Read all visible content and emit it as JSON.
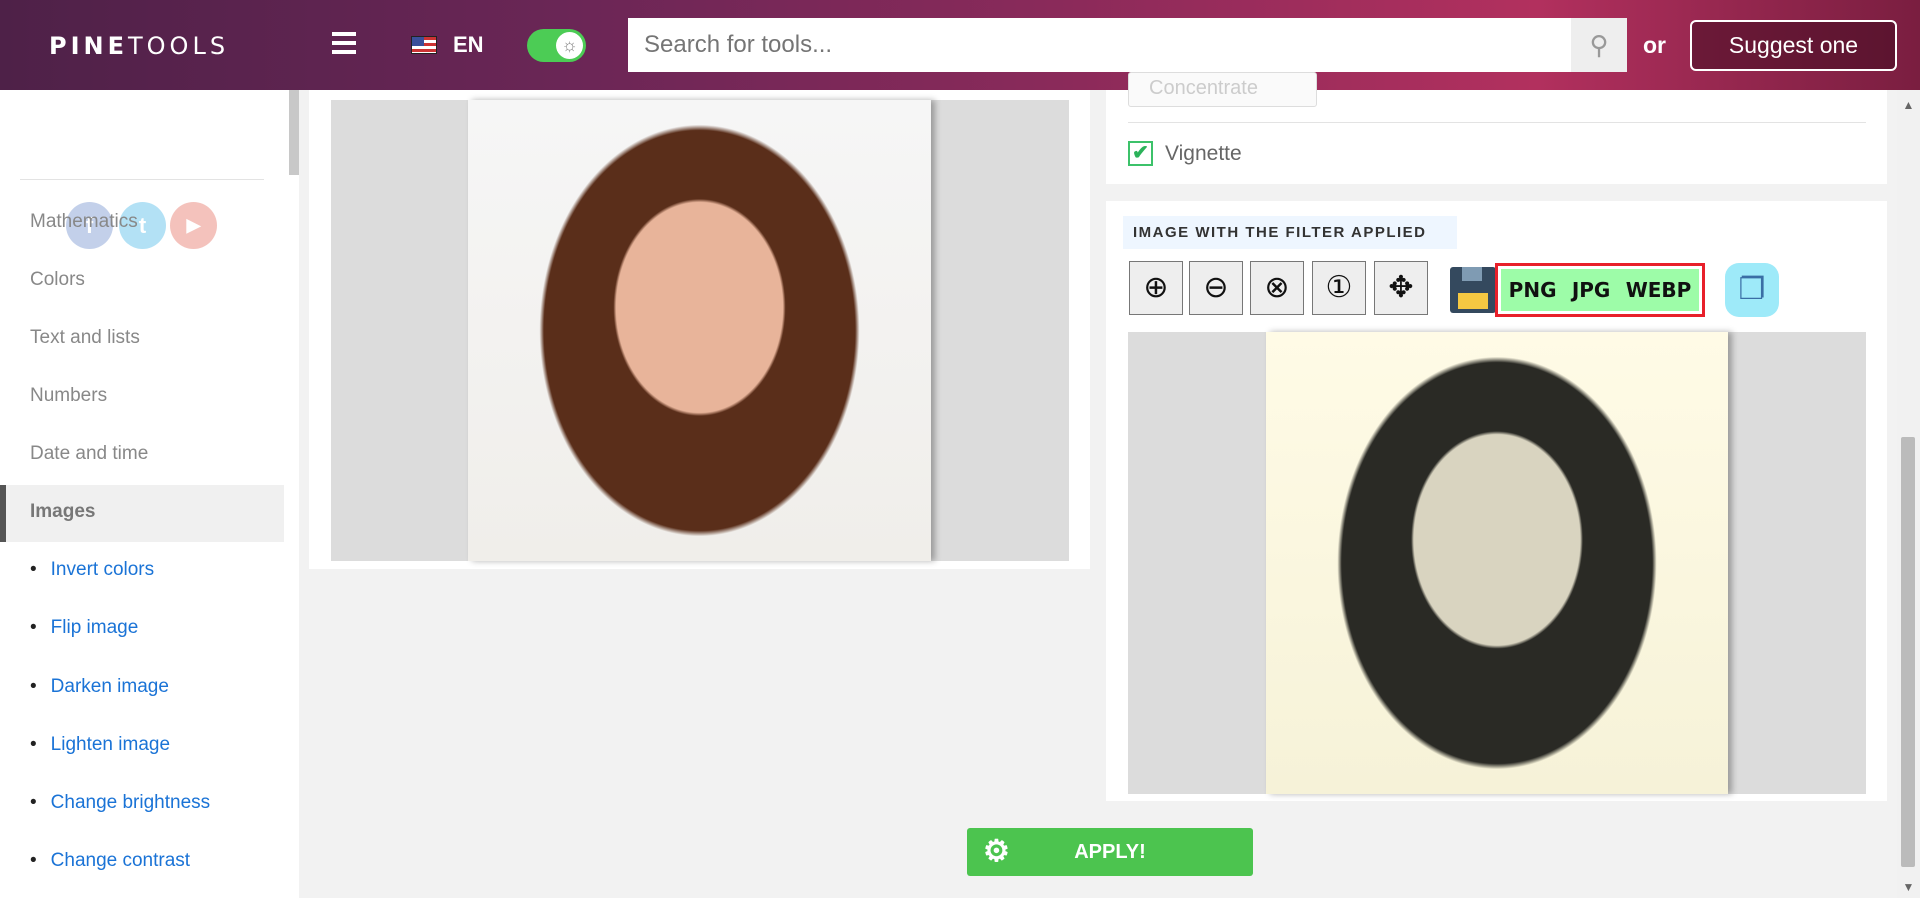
{
  "header": {
    "logo_bold": "PINE",
    "logo_light": "TOOLS",
    "language": "EN",
    "search_placeholder": "Search for tools...",
    "or": "or",
    "suggest": "Suggest one"
  },
  "sidebar": {
    "social": [
      "f",
      "t",
      "▶"
    ],
    "categories": [
      "Mathematics",
      "Colors",
      "Text and lists",
      "Numbers",
      "Date and time",
      "Images"
    ],
    "active": "Images",
    "sub_items": [
      "Invert colors",
      "Flip image",
      "Darken image",
      "Lighten image",
      "Change brightness",
      "Change contrast"
    ]
  },
  "options": {
    "partial_button": "Concentrate",
    "vignette_label": "Vignette",
    "vignette_checked": true
  },
  "result": {
    "title": "IMAGE WITH THE FILTER APPLIED",
    "formats": [
      "PNG",
      "JPG",
      "WEBP"
    ]
  },
  "apply_label": "APPLY!"
}
